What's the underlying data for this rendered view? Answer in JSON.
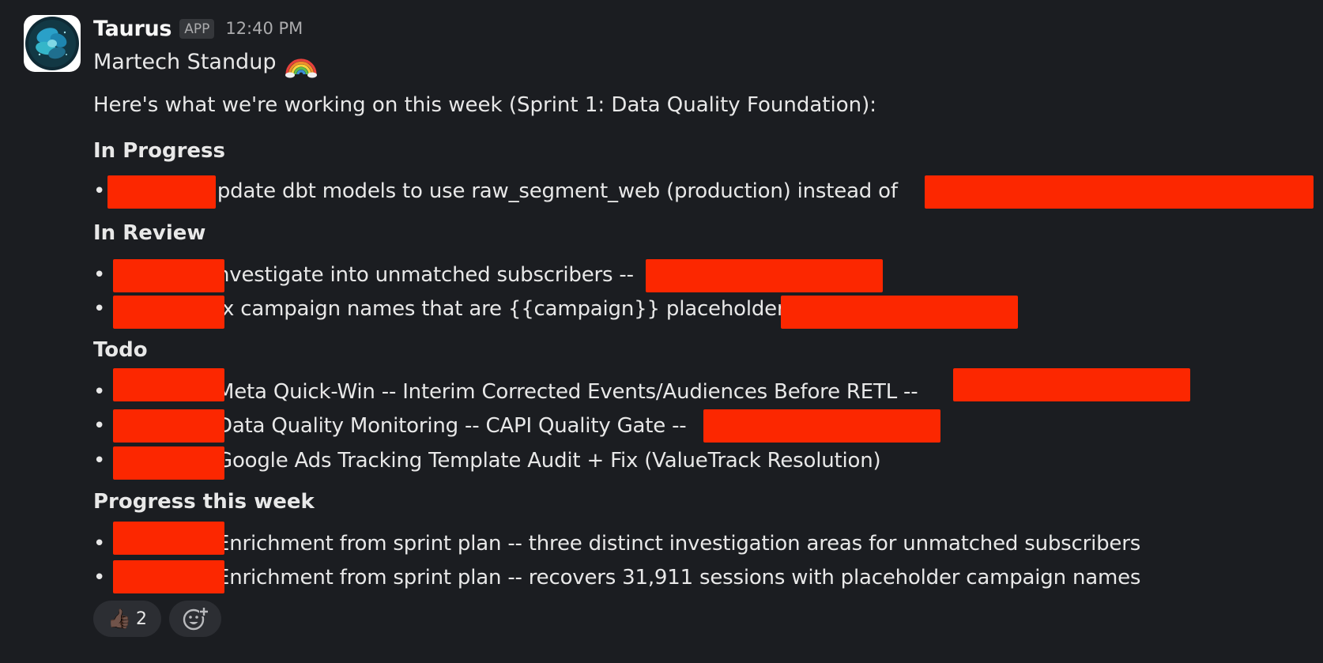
{
  "message": {
    "sender": "Taurus",
    "badge": "APP",
    "timestamp": "12:40 PM",
    "subtitle": "Martech Standup",
    "subtitle_emoji": "rainbow-emoji",
    "intro": "Here's what we're working on this week (Sprint 1: Data Quality Foundation):"
  },
  "sections": {
    "in_progress": {
      "title": "In Progress",
      "items": [
        "Update dbt models to use raw_segment_web (production) instead of"
      ]
    },
    "in_review": {
      "title": "In Review",
      "items": [
        "nvestigate into unmatched subscribers --",
        "ix campaign names that are {{campaign}} placeholder --"
      ]
    },
    "todo": {
      "title": "Todo",
      "items": [
        "Meta Quick-Win -- Interim Corrected Events/Audiences Before RETL --",
        "Data Quality Monitoring -- CAPI Quality Gate --",
        "Google Ads Tracking Template Audit + Fix (ValueTrack Resolution)"
      ]
    },
    "progress": {
      "title": "Progress this week",
      "items": [
        "Enrichment from sprint plan -- three distinct investigation areas for unmatched subscribers",
        "Enrichment from sprint plan -- recovers 31,911 sessions with placeholder campaign names"
      ]
    }
  },
  "reactions": [
    {
      "emoji": "👍🏿",
      "icon": "thumbs-up-icon",
      "count": "2"
    },
    {
      "icon": "add-reaction-icon"
    }
  ],
  "colors": {
    "background": "#1b1d21",
    "redaction": "#fc2700",
    "text": "#e8e8e8",
    "muted": "#ababad"
  }
}
